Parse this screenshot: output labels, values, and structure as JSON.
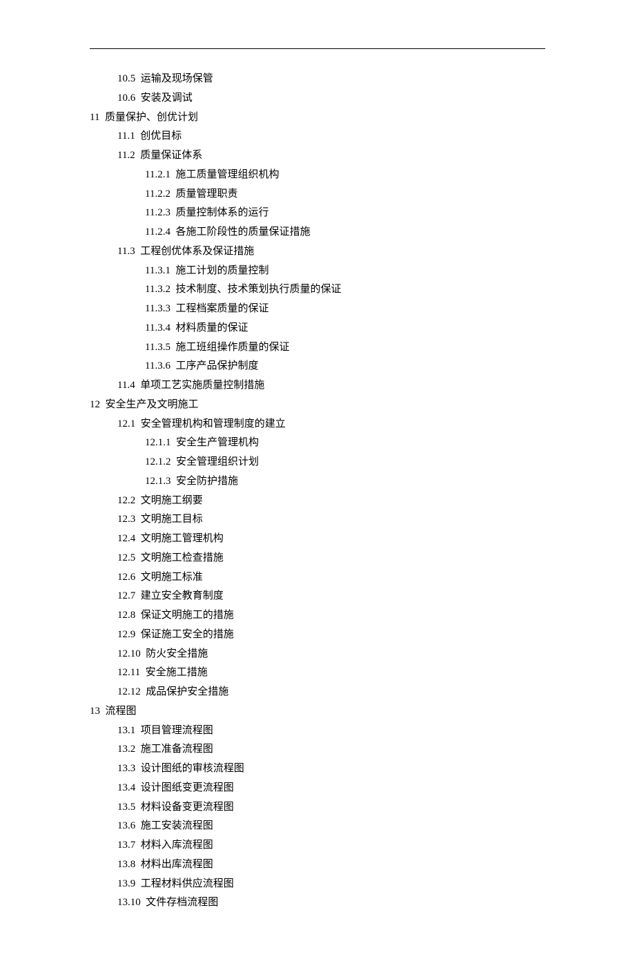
{
  "toc": [
    {
      "level": 2,
      "num": "10.5",
      "title": "运输及现场保管"
    },
    {
      "level": 2,
      "num": "10.6",
      "title": "安装及调试"
    },
    {
      "level": 1,
      "num": "11",
      "title": "质量保护、创优计划"
    },
    {
      "level": 2,
      "num": "11.1",
      "title": "创优目标"
    },
    {
      "level": 2,
      "num": "11.2",
      "title": "质量保证体系"
    },
    {
      "level": 3,
      "num": "11.2.1",
      "title": "施工质量管理组织机构"
    },
    {
      "level": 3,
      "num": "11.2.2",
      "title": "质量管理职责"
    },
    {
      "level": 3,
      "num": "11.2.3",
      "title": "质量控制体系的运行"
    },
    {
      "level": 3,
      "num": "11.2.4",
      "title": "各施工阶段性的质量保证措施"
    },
    {
      "level": 2,
      "num": "11.3",
      "title": "工程创优体系及保证措施"
    },
    {
      "level": 3,
      "num": "11.3.1",
      "title": "施工计划的质量控制"
    },
    {
      "level": 3,
      "num": "11.3.2",
      "title": "技术制度、技术策划执行质量的保证"
    },
    {
      "level": 3,
      "num": "11.3.3",
      "title": "工程档案质量的保证"
    },
    {
      "level": 3,
      "num": "11.3.4",
      "title": "材料质量的保证"
    },
    {
      "level": 3,
      "num": "11.3.5",
      "title": "施工班组操作质量的保证"
    },
    {
      "level": 3,
      "num": "11.3.6",
      "title": "工序产品保护制度"
    },
    {
      "level": 2,
      "num": "11.4",
      "title": "单项工艺实施质量控制措施"
    },
    {
      "level": 1,
      "num": "12",
      "title": "安全生产及文明施工"
    },
    {
      "level": 2,
      "num": "12.1",
      "title": "安全管理机构和管理制度的建立"
    },
    {
      "level": 3,
      "num": "12.1.1",
      "title": "安全生产管理机构"
    },
    {
      "level": 3,
      "num": "12.1.2",
      "title": "安全管理组织计划"
    },
    {
      "level": 3,
      "num": "12.1.3",
      "title": "安全防护措施"
    },
    {
      "level": 2,
      "num": "12.2",
      "title": "文明施工纲要"
    },
    {
      "level": 2,
      "num": "12.3",
      "title": "文明施工目标"
    },
    {
      "level": 2,
      "num": "12.4",
      "title": "文明施工管理机构"
    },
    {
      "level": 2,
      "num": "12.5",
      "title": "文明施工检查措施"
    },
    {
      "level": 2,
      "num": "12.6",
      "title": "文明施工标准"
    },
    {
      "level": 2,
      "num": "12.7",
      "title": "建立安全教育制度"
    },
    {
      "level": 2,
      "num": "12.8",
      "title": "保证文明施工的措施"
    },
    {
      "level": 2,
      "num": "12.9",
      "title": "保证施工安全的措施"
    },
    {
      "level": 2,
      "num": "12.10",
      "title": "防火安全措施"
    },
    {
      "level": 2,
      "num": "12.11",
      "title": "安全施工措施"
    },
    {
      "level": 2,
      "num": "12.12",
      "title": "成品保护安全措施"
    },
    {
      "level": 1,
      "num": "13",
      "title": "流程图"
    },
    {
      "level": 2,
      "num": "13.1",
      "title": "项目管理流程图"
    },
    {
      "level": 2,
      "num": "13.2",
      "title": "施工准备流程图"
    },
    {
      "level": 2,
      "num": "13.3",
      "title": "设计图纸的审核流程图"
    },
    {
      "level": 2,
      "num": "13.4",
      "title": "设计图纸变更流程图"
    },
    {
      "level": 2,
      "num": "13.5",
      "title": "材料设备变更流程图"
    },
    {
      "level": 2,
      "num": "13.6",
      "title": "施工安装流程图"
    },
    {
      "level": 2,
      "num": "13.7",
      "title": "材料入库流程图"
    },
    {
      "level": 2,
      "num": "13.8",
      "title": "材料出库流程图"
    },
    {
      "level": 2,
      "num": "13.9",
      "title": "工程材料供应流程图"
    },
    {
      "level": 2,
      "num": "13.10",
      "title": "文件存档流程图"
    }
  ]
}
